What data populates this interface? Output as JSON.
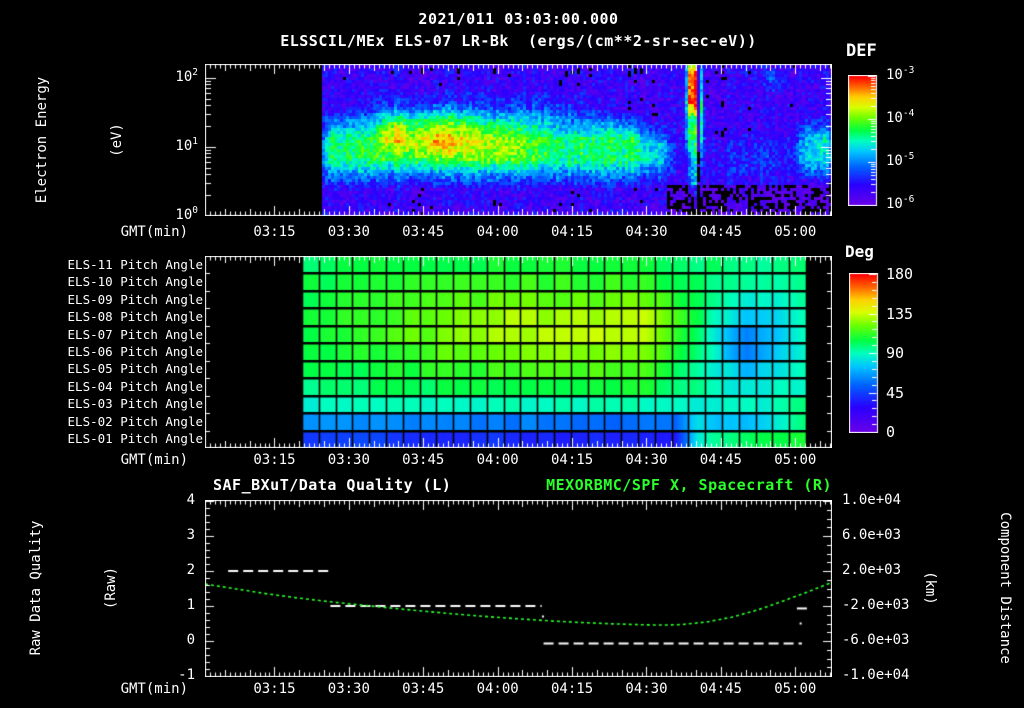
{
  "titles": {
    "datetime": "2021/011 03:03:00.000",
    "instrument": "ELSSCIL/MEx ELS-07 LR-Bk  (ergs/(cm**2-sr-sec-eV))"
  },
  "time_axis": {
    "label": "GMT(min)",
    "tick_labels": [
      "03:15",
      "03:30",
      "03:45",
      "04:00",
      "04:15",
      "04:30",
      "04:45",
      "05:00"
    ],
    "start_min": 181,
    "end_min": 307.4,
    "tick_start_min": 195,
    "tick_step_min": 15
  },
  "colors": {
    "background": "#000000",
    "foreground": "#ffffff",
    "accent_green": "#2bff2b",
    "colormap_stops": [
      [
        0,
        "#6a00e8"
      ],
      [
        0.16,
        "#2a00ff"
      ],
      [
        0.3,
        "#0063ff"
      ],
      [
        0.42,
        "#00c8ff"
      ],
      [
        0.5,
        "#00ffc0"
      ],
      [
        0.58,
        "#00ff44"
      ],
      [
        0.68,
        "#6eff00"
      ],
      [
        0.76,
        "#d8ff00"
      ],
      [
        0.84,
        "#ffd000"
      ],
      [
        0.92,
        "#ff6400"
      ],
      [
        1,
        "#ff0000"
      ]
    ]
  },
  "panel_energy": {
    "ylabel_line1": "Electron Energy",
    "ylabel_line2": "(eV)",
    "ytick_labels": [
      "10^2",
      "10^1",
      "10^0"
    ],
    "ytick_lg": [
      2,
      1,
      0
    ],
    "colorbar": {
      "title": "DEF",
      "tick_labels": [
        "10^-3",
        "10^-4",
        "10^-5",
        "10^-6"
      ]
    }
  },
  "panel_pitch": {
    "colorbar": {
      "title": "Deg",
      "tick_labels": [
        "180",
        "135",
        "90",
        "45",
        "0"
      ],
      "tick_values": [
        180,
        135,
        90,
        45,
        0
      ]
    }
  },
  "panel_quality": {
    "title_left": "SAF_BXuT/Data Quality (L)",
    "title_right": "MEXORBMC/SPF X, Spacecraft (R)",
    "ylabel_line1": "Raw Data Quality",
    "ylabel_line2": "(Raw)",
    "yticks_left": [
      {
        "label": "4",
        "v": 4
      },
      {
        "label": "3",
        "v": 3
      },
      {
        "label": "2",
        "v": 2
      },
      {
        "label": "1",
        "v": 1
      },
      {
        "label": "0",
        "v": 0
      },
      {
        "label": "-1",
        "v": -1
      }
    ],
    "ylabel_right_line1": "Component Distance",
    "ylabel_right_line2": "(km)",
    "yticks_right": [
      {
        "label": "1.0e+04",
        "km": 10000
      },
      {
        "label": "6.0e+03",
        "km": 6000
      },
      {
        "label": "2.0e+03",
        "km": 2000
      },
      {
        "label": "-2.0e+03",
        "km": -2000
      },
      {
        "label": "-6.0e+03",
        "km": -6000
      },
      {
        "label": "-1.0e+04",
        "km": -10000
      }
    ]
  },
  "chart_data": [
    {
      "type": "heatmap",
      "name": "electron-energy-spectrogram",
      "title": "ELSSCIL/MEx ELS-07 LR-Bk",
      "units": "ergs/(cm**2-sr-sec-eV)",
      "x_axis": {
        "label": "GMT(min)",
        "start": "03:01",
        "end": "05:07",
        "tick_labels": [
          "03:15",
          "03:30",
          "03:45",
          "04:00",
          "04:15",
          "04:30",
          "04:45",
          "05:00"
        ]
      },
      "y_axis": {
        "label": "Electron Energy (eV)",
        "scale": "log",
        "min_ev": 1,
        "max_ev": 158,
        "tick_labels": [
          "10^2",
          "10^1",
          "10^0"
        ]
      },
      "z_axis": {
        "label": "DEF",
        "min": 1e-06,
        "max": 0.001,
        "tick_labels": [
          "10^-3",
          "10^-4",
          "10^-5",
          "10^-6"
        ]
      },
      "data_start_frac": 0.1866,
      "background_level": 0.27,
      "noise_amp": 0.24,
      "features": [
        {
          "name": "main-band",
          "t0": 0.19,
          "t1": 0.695,
          "wt": 0.012,
          "lg0": 0.58,
          "lg1": 1.32,
          "wl": 0.22,
          "amp": 0.55
        },
        {
          "name": "band-bright",
          "t0": 0.3,
          "t1": 0.52,
          "wt": 0.05,
          "lg0": 0.78,
          "lg1": 1.42,
          "wl": 0.18,
          "amp": 0.2
        },
        {
          "name": "hotspot-red",
          "t0": 0.283,
          "t1": 0.318,
          "wt": 0.012,
          "lg0": 1.02,
          "lg1": 1.42,
          "wl": 0.15,
          "amp": 0.3
        },
        {
          "name": "yellow-ridge",
          "t0": 0.33,
          "t1": 0.42,
          "wt": 0.03,
          "lg0": 0.95,
          "lg1": 1.5,
          "wl": 0.15,
          "amp": 0.16
        },
        {
          "name": "upper-haze",
          "t0": 0.25,
          "t1": 0.6,
          "wt": 0.06,
          "lg0": 1.32,
          "lg1": 1.72,
          "wl": 0.15,
          "amp": 0.16
        },
        {
          "name": "band-taper",
          "t0": 0.695,
          "t1": 0.74,
          "wt": 0.015,
          "lg0": 0.6,
          "lg1": 1.2,
          "wl": 0.2,
          "amp": 0.42
        },
        {
          "name": "stripe-high-e",
          "t0": 0.769,
          "t1": 0.791,
          "wt": 0.004,
          "lg0": 1.55,
          "lg1": 2.2,
          "wl": 0.12,
          "amp": 1.05
        },
        {
          "name": "stripe-mid-e",
          "t0": 0.768,
          "t1": 0.794,
          "wt": 0.005,
          "lg0": 0.95,
          "lg1": 1.6,
          "wl": 0.15,
          "amp": 0.62
        },
        {
          "name": "stripe-low-e",
          "t0": 0.771,
          "t1": 0.79,
          "wt": 0.005,
          "lg0": 0.3,
          "lg1": 0.95,
          "wl": 0.15,
          "amp": 0.35
        },
        {
          "name": "right-cyan-blob",
          "t0": 0.948,
          "t1": 1.01,
          "wt": 0.02,
          "lg0": 0.62,
          "lg1": 1.28,
          "wl": 0.15,
          "amp": 0.4
        },
        {
          "name": "post-haze",
          "t0": 0.8,
          "t1": 0.94,
          "wt": 0.04,
          "lg0": 0.55,
          "lg1": 1.05,
          "wl": 0.15,
          "amp": 0.1
        },
        {
          "name": "high-spot",
          "t0": 0.893,
          "t1": 0.917,
          "wt": 0.01,
          "lg0": 1.85,
          "lg1": 2.1,
          "wl": 0.1,
          "amp": 0.16
        }
      ],
      "dark_slit": {
        "t0": 0.7835,
        "t1": 0.7875,
        "mult": 0.22
      },
      "dark_low_region": {
        "t0": 0.735,
        "t1": 1.0,
        "lg_max": 0.45,
        "base": 0.14
      }
    },
    {
      "type": "heatmap",
      "name": "pitch-angle-panels",
      "value_axis": {
        "label": "Deg",
        "min": 0,
        "max": 180
      },
      "data_start_frac": 0.1547,
      "data_end_frac": 0.9585,
      "columns": 30,
      "rows": [
        {
          "label": "ELS-11 Pitch Angle",
          "points": [
            [
              0,
              102
            ],
            [
              0.4,
              107
            ],
            [
              0.68,
              105
            ],
            [
              0.78,
              100
            ],
            [
              0.9,
              96
            ],
            [
              1,
              100
            ]
          ]
        },
        {
          "label": "ELS-10 Pitch Angle",
          "points": [
            [
              0,
              104
            ],
            [
              0.4,
              113
            ],
            [
              0.68,
              112
            ],
            [
              0.78,
              100
            ],
            [
              0.9,
              93
            ],
            [
              1,
              100
            ]
          ]
        },
        {
          "label": "ELS-09 Pitch Angle",
          "points": [
            [
              0,
              105
            ],
            [
              0.4,
              121
            ],
            [
              0.68,
              121
            ],
            [
              0.78,
              102
            ],
            [
              0.88,
              88
            ],
            [
              0.93,
              85
            ],
            [
              1,
              97
            ]
          ]
        },
        {
          "label": "ELS-08 Pitch Angle",
          "points": [
            [
              0,
              106
            ],
            [
              0.4,
              129
            ],
            [
              0.68,
              132
            ],
            [
              0.78,
              103
            ],
            [
              0.88,
              72
            ],
            [
              0.93,
              78
            ],
            [
              1,
              94
            ]
          ]
        },
        {
          "label": "ELS-07 Pitch Angle",
          "points": [
            [
              0,
              106
            ],
            [
              0.4,
              130
            ],
            [
              0.68,
              134
            ],
            [
              0.78,
              103
            ],
            [
              0.88,
              62
            ],
            [
              0.93,
              72
            ],
            [
              1,
              91
            ]
          ]
        },
        {
          "label": "ELS-06 Pitch Angle",
          "points": [
            [
              0,
              104
            ],
            [
              0.4,
              124
            ],
            [
              0.68,
              127
            ],
            [
              0.78,
              100
            ],
            [
              0.88,
              60
            ],
            [
              0.93,
              72
            ],
            [
              1,
              89
            ]
          ]
        },
        {
          "label": "ELS-05 Pitch Angle",
          "points": [
            [
              0,
              101
            ],
            [
              0.4,
              114
            ],
            [
              0.68,
              116
            ],
            [
              0.78,
              97
            ],
            [
              0.88,
              73
            ],
            [
              0.93,
              80
            ],
            [
              1,
              90
            ]
          ]
        },
        {
          "label": "ELS-04 Pitch Angle",
          "points": [
            [
              0,
              97
            ],
            [
              0.4,
              105
            ],
            [
              0.68,
              107
            ],
            [
              0.78,
              94
            ],
            [
              0.88,
              83
            ],
            [
              1,
              92
            ]
          ]
        },
        {
          "label": "ELS-03 Pitch Angle",
          "points": [
            [
              0,
              88
            ],
            [
              0.4,
              90
            ],
            [
              0.68,
              92
            ],
            [
              0.78,
              88
            ],
            [
              0.88,
              86
            ],
            [
              1,
              96
            ]
          ]
        },
        {
          "label": "ELS-02 Pitch Angle",
          "points": [
            [
              0,
              66
            ],
            [
              0.4,
              60
            ],
            [
              0.65,
              55
            ],
            [
              0.74,
              57
            ],
            [
              0.785,
              82
            ],
            [
              0.85,
              72
            ],
            [
              0.92,
              82
            ],
            [
              1,
              96
            ]
          ]
        },
        {
          "label": "ELS-01 Pitch Angle",
          "points": [
            [
              0,
              46
            ],
            [
              0.4,
              40
            ],
            [
              0.65,
              36
            ],
            [
              0.74,
              38
            ],
            [
              0.785,
              86
            ],
            [
              0.85,
              96
            ],
            [
              0.92,
              104
            ],
            [
              1,
              108
            ]
          ]
        }
      ]
    },
    {
      "type": "line",
      "name": "quality-and-spacecraft-x",
      "left_axis": {
        "label": "Raw Data Quality (Raw)",
        "min": -1,
        "max": 4
      },
      "right_axis": {
        "label": "Component Distance (km)",
        "min": -10000,
        "max": 10000
      },
      "series": [
        {
          "name": "SAF_BXuT/Data Quality (L)",
          "axis": "left",
          "style": "dashed",
          "color": "#ffffff",
          "segments": [
            {
              "f0": 0.037,
              "f1": 0.203,
              "v": 2.0
            },
            {
              "f0": 0.2,
              "f1": 0.537,
              "v": 1.0
            },
            {
              "f0": 0.54,
              "f1": 0.952,
              "v": -0.07
            },
            {
              "f0": 0.944,
              "f1": 0.961,
              "v": 0.93
            }
          ],
          "points": [
            {
              "f": 0.539,
              "v": 0.7
            },
            {
              "f": 0.95,
              "v": 0.5
            }
          ]
        },
        {
          "name": "MEXORBMC/SPF X, Spacecraft (R)",
          "axis": "right",
          "style": "dotted",
          "color": "#2bff2b",
          "points_f_km": [
            [
              0,
              500
            ],
            [
              0.05,
              -50
            ],
            [
              0.1,
              -620
            ],
            [
              0.15,
              -1100
            ],
            [
              0.2,
              -1520
            ],
            [
              0.25,
              -1900
            ],
            [
              0.3,
              -2260
            ],
            [
              0.35,
              -2600
            ],
            [
              0.4,
              -2920
            ],
            [
              0.45,
              -3210
            ],
            [
              0.5,
              -3470
            ],
            [
              0.55,
              -3700
            ],
            [
              0.6,
              -3890
            ],
            [
              0.65,
              -4040
            ],
            [
              0.7,
              -4150
            ],
            [
              0.73,
              -4180
            ],
            [
              0.76,
              -4120
            ],
            [
              0.8,
              -3830
            ],
            [
              0.84,
              -3280
            ],
            [
              0.88,
              -2480
            ],
            [
              0.92,
              -1480
            ],
            [
              0.96,
              -420
            ],
            [
              1.0,
              700
            ]
          ]
        }
      ]
    }
  ]
}
